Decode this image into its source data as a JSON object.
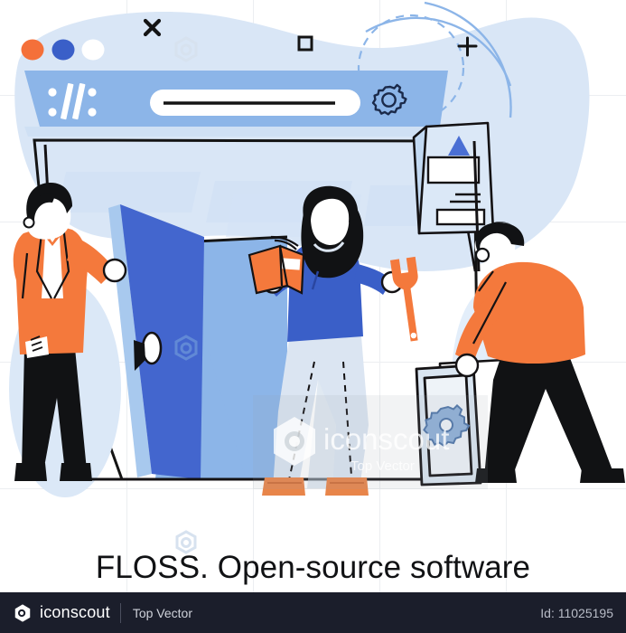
{
  "illustration": {
    "title": "FLOSS. Open-source software",
    "browser_mock": {
      "dots": [
        {
          "name": "orange-dot",
          "color": "#f4703a"
        },
        {
          "name": "blue-dot",
          "color": "#3a5fc8"
        },
        {
          "name": "white-dot",
          "color": "#ffffff"
        }
      ],
      "url_scheme_glyph": "://",
      "address_bar_value": "",
      "settings_icon": "gear-icon",
      "bar_color": "#8cb5e8"
    },
    "decor": {
      "close_glyph": "×",
      "square_glyph": "□",
      "plus_glyph": "+",
      "blob_color": "#d3e2f5",
      "arc_color": "#8cb5e8"
    },
    "characters": [
      {
        "name": "man-opening-door",
        "jacket_color": "#f4793c",
        "pants_color": "#111214",
        "holds": "door-handle"
      },
      {
        "name": "woman-with-book-and-wrench",
        "top_color": "#3a5fc8",
        "pants_color": "#dbe5f2",
        "shoes_color": "#e8854a",
        "holds_left": "orange-book",
        "holds_right": "orange-wrench"
      },
      {
        "name": "man-carrying-panel",
        "shirt_color": "#f4793c",
        "pants_color": "#111214",
        "holds": "settings-panel"
      }
    ],
    "door": {
      "name": "open-door",
      "front_color": "#3a5fc8",
      "inner_color": "#8cb5e8",
      "edge_color": "#a8c9ee"
    },
    "floating_card": {
      "name": "floating-info-card",
      "triangle_color": "#4a6fd4",
      "face_color": "#dbe8f7"
    },
    "carried_panel": {
      "name": "settings-frame",
      "gear_color": "#8fb0d8"
    }
  },
  "watermark": {
    "main": "iconscout",
    "sub": "Top Vector"
  },
  "footer": {
    "brand": "iconscout",
    "sub_brand": "Top Vector",
    "asset_id": "Id: 11025195",
    "background": "#1b1e2b"
  }
}
